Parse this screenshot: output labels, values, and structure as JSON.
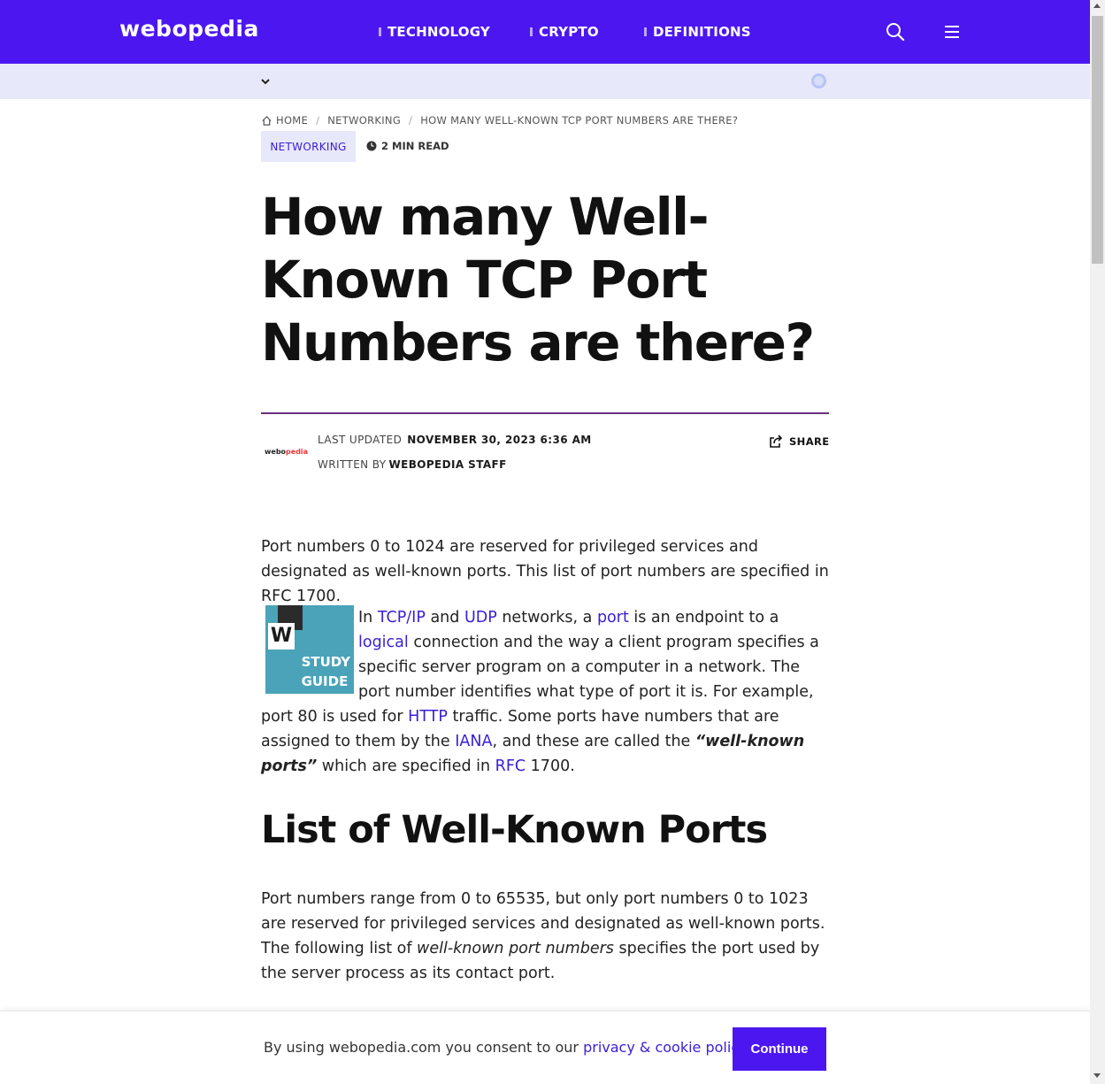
{
  "header": {
    "logo": "webopedia",
    "nav": [
      "TECHNOLOGY",
      "CRYPTO",
      "DEFINITIONS"
    ],
    "search_icon": "search-icon",
    "menu_icon": "hamburger-menu-icon"
  },
  "breadcrumb": {
    "home": "HOME",
    "section": "NETWORKING",
    "current": "HOW MANY WELL-KNOWN TCP PORT NUMBERS ARE THERE?"
  },
  "article": {
    "tag": "NETWORKING",
    "read_time": "2 MIN READ",
    "title": "How many Well-Known TCP Port Numbers are there?",
    "author_logo_text_a": "webo",
    "author_logo_text_b": "pedia",
    "last_updated_label": "LAST UPDATED",
    "last_updated_value": "NOVEMBER 30, 2023 6:36 AM",
    "written_by_label": "WRITTEN BY",
    "written_by_value": "WEBOPEDIA STAFF",
    "share_label": "SHARE",
    "intro": "Port numbers 0 to 1024 are reserved for privileged services and designated as well-known ports. This list of port numbers are specified in RFC 1700.",
    "study_guide": {
      "letter": "W",
      "line1": "STUDY",
      "line2": "GUIDE"
    },
    "body": {
      "t1": "In ",
      "l1": "TCP/IP",
      "t2": " and ",
      "l2": "UDP",
      "t3": " networks, a ",
      "l3": "port",
      "t4": " is an endpoint to a ",
      "l4": "logical",
      "t5": " connection and the way a client program specifies a specific server program on a computer in a network. The port number identifies what type of port it is. For example, port 80 is used for ",
      "l5": "HTTP",
      "t6": " traffic. Some ports have numbers that are assigned to them by the ",
      "l6": "IANA",
      "t7": ", and these are called the ",
      "em": "“well-known ports”",
      "t8": " which are specified in ",
      "l7": "RFC",
      "t9": " 1700."
    },
    "subheading": "List of Well-Known Ports",
    "p3": {
      "t1": "Port numbers range from 0 to 65535, but only port numbers 0 to 1023 are reserved for privileged services and designated as well-known ports. The following list of ",
      "em": "well-known port numbers",
      "t2": " specifies the port used by the server process as its contact port."
    }
  },
  "consent": {
    "text": "By using webopedia.com you consent to our ",
    "link": "privacy & cookie policy",
    "suffix": ".",
    "button": "Continue"
  },
  "colors": {
    "brand": "#4c16f0",
    "link": "#3a20d6",
    "subbar": "#e8e8fb"
  }
}
